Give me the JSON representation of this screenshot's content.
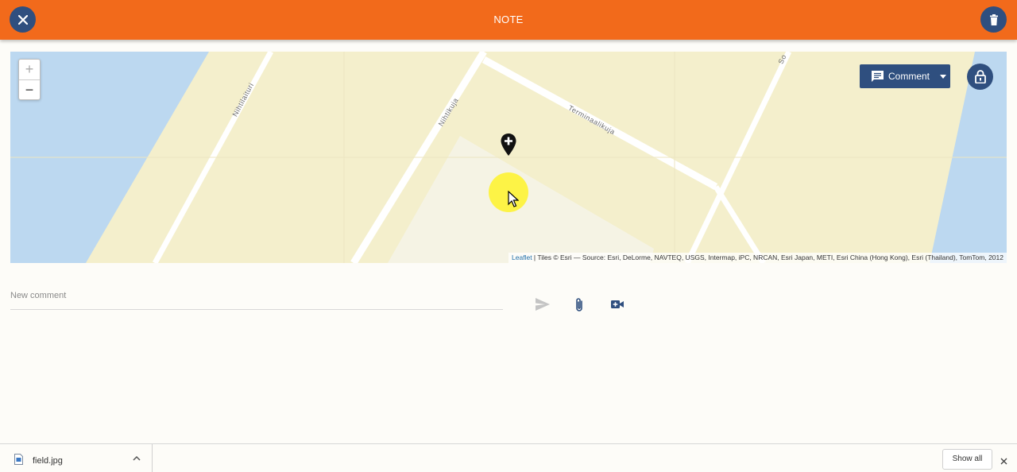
{
  "header": {
    "title": "NOTE",
    "close_icon": "close-icon",
    "delete_icon": "trash-icon"
  },
  "map": {
    "zoom_in_label": "+",
    "zoom_out_label": "−",
    "streets": [
      "Nihtilaituri",
      "Nihtikuja",
      "Terminaalikuja",
      "So"
    ],
    "comment_button_label": "Comment",
    "comment_icon": "chat-bubble-icon",
    "lock_icon": "lock-icon",
    "marker_icon": "map-pin-plus-icon",
    "attribution_link": "Leaflet",
    "attribution_text": " | Tiles © Esri — Source: Esri, DeLorme, NAVTEQ, USGS, Intermap, iPC, NRCAN, Esri Japan, METI, Esri China (Hong Kong), Esri (Thailand), TomTom, 2012",
    "colors": {
      "land": "#f4efcc",
      "water": "#bcd8f0",
      "road": "#ffffff",
      "plaza": "#f5f3e4"
    }
  },
  "composer": {
    "placeholder": "New comment",
    "send_icon": "send-icon",
    "attach_icon": "paperclip-icon",
    "video_icon": "video-camera-plus-icon"
  },
  "downloads": {
    "file_name": "field.jpg",
    "show_all_label": "Show all",
    "close_label": "✕"
  },
  "colors": {
    "header": "#f26a1b",
    "accent": "#2f4f7f"
  }
}
